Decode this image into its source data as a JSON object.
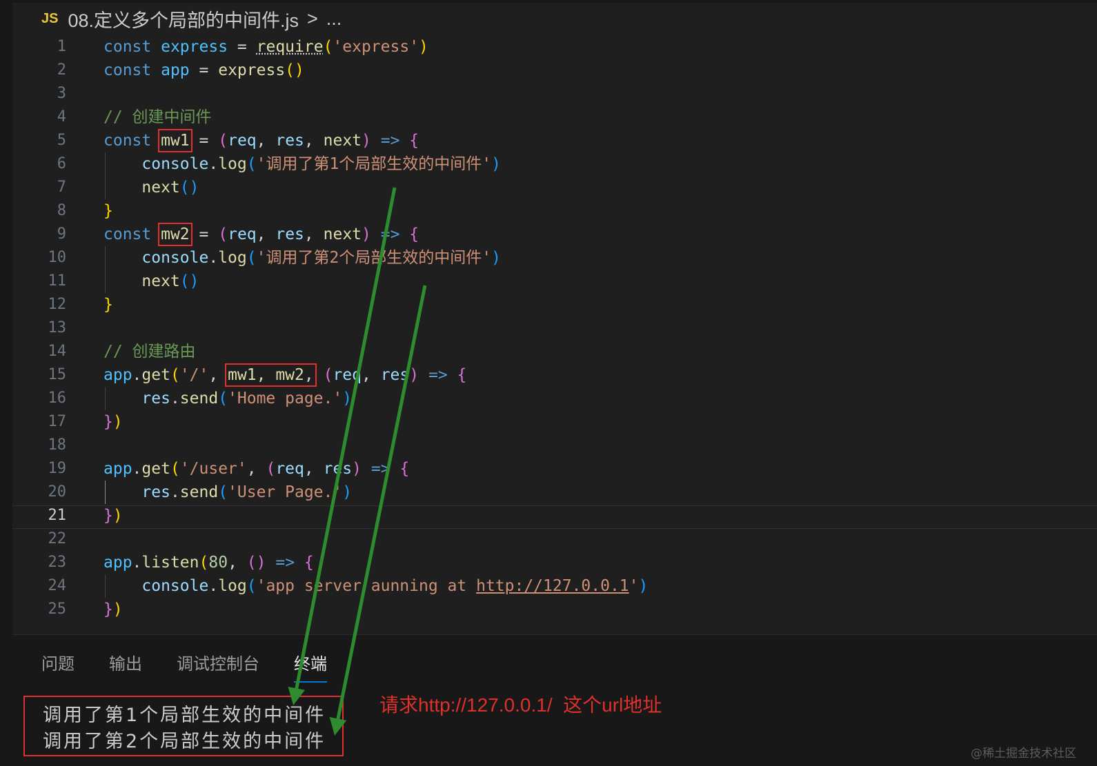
{
  "breadcrumb": {
    "badge": "JS",
    "file": "08.定义多个局部的中间件.js",
    "sep": ">",
    "more": "..."
  },
  "editor": {
    "line_numbers": [
      "1",
      "2",
      "3",
      "4",
      "5",
      "6",
      "7",
      "8",
      "9",
      "10",
      "11",
      "12",
      "13",
      "14",
      "15",
      "16",
      "17",
      "18",
      "19",
      "20",
      "21",
      "22",
      "23",
      "24",
      "25"
    ],
    "active_line": "21",
    "code": {
      "kw_const": "const",
      "express": "express",
      "require": "require",
      "str_express": "'express'",
      "app": "app",
      "comment_mw": "// 创建中间件",
      "mw1": "mw1",
      "mw2": "mw2",
      "req": "req",
      "res": "res",
      "next": "next",
      "arrow": "=>",
      "console": "console",
      "log": "log",
      "send": "send",
      "get": "get",
      "listen": "listen",
      "str_mw1": "'调用了第1个局部生效的中间件'",
      "str_mw2": "'调用了第2个局部生效的中间件'",
      "comment_route": "// 创建路由",
      "str_root": "'/'",
      "mws": "mw1, mw2",
      "str_home": "'Home page.'",
      "str_user": "'/user'",
      "str_userpage": "'User Page.'",
      "port": "80",
      "str_server_prefix": "'app server aunning at ",
      "url": "http://127.0.0.1",
      "str_quote": "'"
    }
  },
  "panel": {
    "tabs": [
      "问题",
      "输出",
      "调试控制台",
      "终端"
    ],
    "active_tab": "终端",
    "terminal_lines": [
      "调用了第1个局部生效的中间件",
      "调用了第2个局部生效的中间件"
    ]
  },
  "annotation": "请求http://127.0.0.1/  这个url地址",
  "watermark": "@稀土掘金技术社区",
  "colors": {
    "highlight_box": "#e03030",
    "arrow": "#2e8b2e",
    "annotation": "#e0302a"
  }
}
